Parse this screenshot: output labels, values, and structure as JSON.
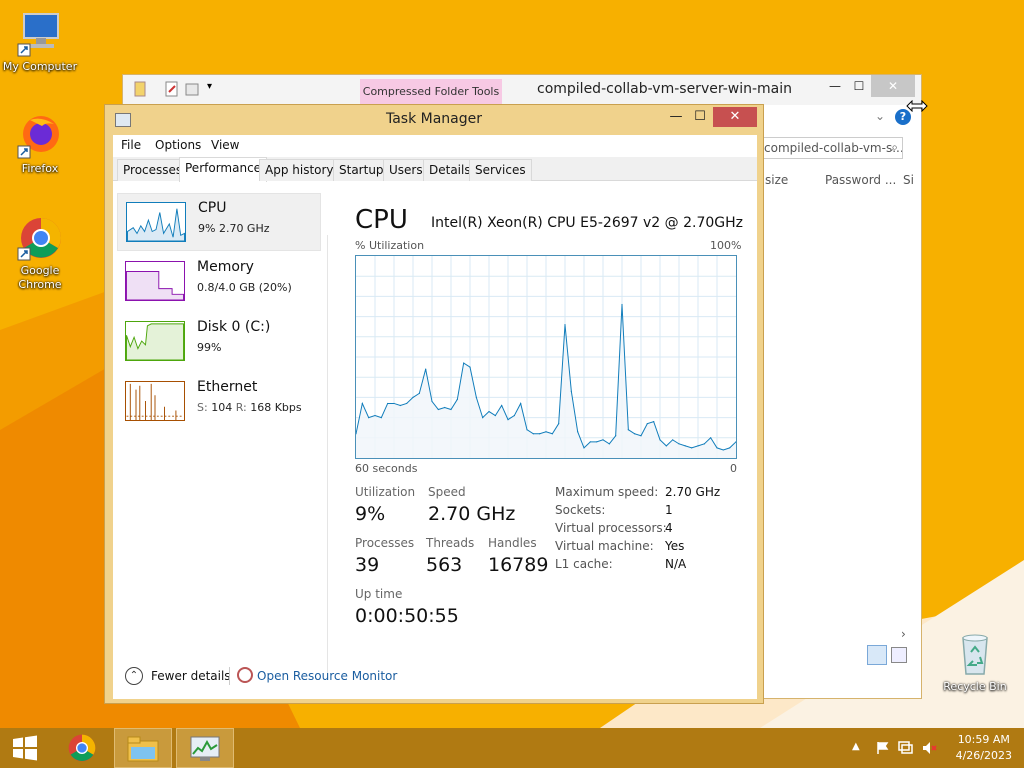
{
  "desktop": {
    "icons": [
      {
        "label": "My Computer",
        "icon": "computer-icon"
      },
      {
        "label": "Firefox",
        "icon": "firefox-icon"
      },
      {
        "label": "Google Chrome",
        "icon": "chrome-icon"
      },
      {
        "label": "Recycle Bin",
        "icon": "recycle-bin-icon"
      }
    ]
  },
  "explorer": {
    "context_tab": "Compressed Folder Tools",
    "title": "compiled-collab-vm-server-win-main",
    "search_text": "compiled-collab-vm-s...",
    "columns": [
      "size",
      "Password ...",
      "Si"
    ]
  },
  "task_manager": {
    "title": "Task Manager",
    "menu": [
      "File",
      "Options",
      "View"
    ],
    "tabs": [
      "Processes",
      "Performance",
      "App history",
      "Startup",
      "Users",
      "Details",
      "Services"
    ],
    "active_tab": "Performance",
    "sidebar": [
      {
        "name": "CPU",
        "detail": "9%  2.70 GHz",
        "color": "#117dbb"
      },
      {
        "name": "Memory",
        "detail": "0.8/4.0 GB (20%)",
        "color": "#8b12ae"
      },
      {
        "name": "Disk 0 (C:)",
        "detail": "99%",
        "color": "#4da60c"
      },
      {
        "name": "Ethernet",
        "detail_s_label": "S:",
        "detail_s": "104",
        "detail_r_label": "R:",
        "detail_r": "168 Kbps",
        "color": "#a74f01"
      }
    ],
    "detail": {
      "heading": "CPU",
      "model": "Intel(R) Xeon(R) CPU E5-2697 v2 @ 2.70GHz",
      "y_label": "% Utilization",
      "y_max": "100%",
      "x_label": "60 seconds",
      "x_min": "0"
    },
    "stats": {
      "utilization_label": "Utilization",
      "utilization": "9%",
      "speed_label": "Speed",
      "speed": "2.70 GHz",
      "processes_label": "Processes",
      "processes": "39",
      "threads_label": "Threads",
      "threads": "563",
      "handles_label": "Handles",
      "handles": "16789",
      "uptime_label": "Up time",
      "uptime": "0:00:50:55"
    },
    "properties": [
      {
        "label": "Maximum speed:",
        "value": "2.70 GHz"
      },
      {
        "label": "Sockets:",
        "value": "1"
      },
      {
        "label": "Virtual processors:",
        "value": "4"
      },
      {
        "label": "Virtual machine:",
        "value": "Yes"
      },
      {
        "label": "L1 cache:",
        "value": "N/A"
      }
    ],
    "footer": {
      "fewer_details": "Fewer details",
      "open_resource_monitor": "Open Resource Monitor"
    }
  },
  "chart_data": {
    "type": "area",
    "xlabel": "60 seconds",
    "ylabel": "% Utilization",
    "ylim": [
      0,
      100
    ],
    "x": [
      60,
      59,
      58,
      57,
      56,
      55,
      54,
      53,
      52,
      51,
      50,
      49,
      48,
      47,
      46,
      45,
      44,
      43,
      42,
      41,
      40,
      39,
      38,
      37,
      36,
      35,
      34,
      33,
      32,
      31,
      30,
      29,
      28,
      27,
      26,
      25,
      24,
      23,
      22,
      21,
      20,
      19,
      18,
      17,
      16,
      15,
      14,
      13,
      12,
      11,
      10,
      9,
      8,
      7,
      6,
      5,
      4,
      3,
      2,
      1,
      0
    ],
    "series": [
      {
        "values": [
          12,
          27,
          20,
          21,
          20,
          27,
          27,
          26,
          27,
          30,
          32,
          44,
          28,
          24,
          25,
          24,
          29,
          47,
          45,
          30,
          20,
          23,
          21,
          26,
          19,
          21,
          27,
          14,
          12,
          12,
          13,
          12,
          17,
          66,
          33,
          13,
          5,
          8,
          8,
          9,
          7,
          11,
          76,
          14,
          12,
          11,
          17,
          18,
          9,
          6,
          9,
          7,
          6,
          5,
          6,
          7,
          10,
          5,
          4,
          5,
          8
        ]
      }
    ],
    "grid": true,
    "color": "#117dbb"
  },
  "taskbar": {
    "clock_time": "10:59 AM",
    "clock_date": "4/26/2023",
    "apps": [
      "start",
      "chrome",
      "file-explorer",
      "task-manager"
    ]
  }
}
